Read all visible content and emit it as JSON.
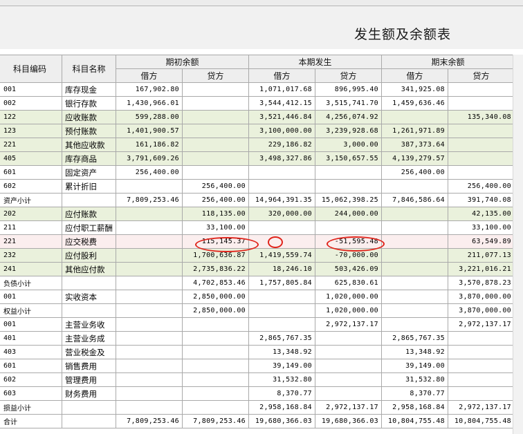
{
  "title": "发生额及余额表",
  "headers": {
    "code": "科目编码",
    "name": "科目名称",
    "groups": [
      "期初余额",
      "本期发生",
      "期末余额"
    ],
    "debit": "借方",
    "credit": "贷方"
  },
  "rows": [
    {
      "code": "001",
      "name": "库存现金",
      "v": [
        "167,902.80",
        "",
        "1,071,017.68",
        "896,995.40",
        "341,925.08",
        ""
      ],
      "hl": ""
    },
    {
      "code": "002",
      "name": "银行存款",
      "v": [
        "1,430,966.01",
        "",
        "3,544,412.15",
        "3,515,741.70",
        "1,459,636.46",
        ""
      ],
      "hl": ""
    },
    {
      "code": "122",
      "name": "应收账款",
      "v": [
        "599,288.00",
        "",
        "3,521,446.84",
        "4,256,074.92",
        "",
        "135,340.08"
      ],
      "hl": "green"
    },
    {
      "code": "123",
      "name": "预付账款",
      "v": [
        "1,401,900.57",
        "",
        "3,100,000.00",
        "3,239,928.68",
        "1,261,971.89",
        ""
      ],
      "hl": "green"
    },
    {
      "code": "221",
      "name": "其他应收款",
      "v": [
        "161,186.82",
        "",
        "229,186.82",
        "3,000.00",
        "387,373.64",
        ""
      ],
      "hl": "green"
    },
    {
      "code": "405",
      "name": "库存商品",
      "v": [
        "3,791,609.26",
        "",
        "3,498,327.86",
        "3,150,657.55",
        "4,139,279.57",
        ""
      ],
      "hl": "green"
    },
    {
      "code": "601",
      "name": "固定资产",
      "v": [
        "256,400.00",
        "",
        "",
        "",
        "256,400.00",
        ""
      ],
      "hl": ""
    },
    {
      "code": "602",
      "name": "累计折旧",
      "v": [
        "",
        "256,400.00",
        "",
        "",
        "",
        "256,400.00"
      ],
      "hl": ""
    },
    {
      "code": "资产小计",
      "name": "",
      "v": [
        "7,809,253.46",
        "256,400.00",
        "14,964,391.35",
        "15,062,398.25",
        "7,846,586.64",
        "391,740.08"
      ],
      "hl": ""
    },
    {
      "code": "202",
      "name": "应付账款",
      "v": [
        "",
        "118,135.00",
        "320,000.00",
        "244,000.00",
        "",
        "42,135.00"
      ],
      "hl": "green"
    },
    {
      "code": "211",
      "name": "应付职工薪酬",
      "v": [
        "",
        "33,100.00",
        "",
        "",
        "",
        "33,100.00"
      ],
      "hl": ""
    },
    {
      "code": "221",
      "name": "应交税费",
      "v": [
        "",
        "115,145.37",
        "",
        "-51,595.48",
        "",
        "63,549.89"
      ],
      "hl": "pink"
    },
    {
      "code": "232",
      "name": "应付股利",
      "v": [
        "",
        "1,700,636.87",
        "1,419,559.74",
        "-70,000.00",
        "",
        "211,077.13"
      ],
      "hl": "green"
    },
    {
      "code": "241",
      "name": "其他应付款",
      "v": [
        "",
        "2,735,836.22",
        "18,246.10",
        "503,426.09",
        "",
        "3,221,016.21"
      ],
      "hl": "green"
    },
    {
      "code": "负债小计",
      "name": "",
      "v": [
        "",
        "4,702,853.46",
        "1,757,805.84",
        "625,830.61",
        "",
        "3,570,878.23"
      ],
      "hl": ""
    },
    {
      "code": "001",
      "name": "实收资本",
      "v": [
        "",
        "2,850,000.00",
        "",
        "1,020,000.00",
        "",
        "3,870,000.00"
      ],
      "hl": ""
    },
    {
      "code": "权益小计",
      "name": "",
      "v": [
        "",
        "2,850,000.00",
        "",
        "1,020,000.00",
        "",
        "3,870,000.00"
      ],
      "hl": ""
    },
    {
      "code": "001",
      "name": "主营业务收",
      "v": [
        "",
        "",
        "",
        "2,972,137.17",
        "",
        "2,972,137.17"
      ],
      "hl": ""
    },
    {
      "code": "401",
      "name": "主营业务成",
      "v": [
        "",
        "",
        "2,865,767.35",
        "",
        "2,865,767.35",
        ""
      ],
      "hl": ""
    },
    {
      "code": "403",
      "name": "营业税金及",
      "v": [
        "",
        "",
        "13,348.92",
        "",
        "13,348.92",
        ""
      ],
      "hl": ""
    },
    {
      "code": "601",
      "name": "销售费用",
      "v": [
        "",
        "",
        "39,149.00",
        "",
        "39,149.00",
        ""
      ],
      "hl": ""
    },
    {
      "code": "602",
      "name": "管理费用",
      "v": [
        "",
        "",
        "31,532.80",
        "",
        "31,532.80",
        ""
      ],
      "hl": ""
    },
    {
      "code": "603",
      "name": "财务费用",
      "v": [
        "",
        "",
        "8,370.77",
        "",
        "8,370.77",
        ""
      ],
      "hl": ""
    },
    {
      "code": "损益小计",
      "name": "",
      "v": [
        "",
        "",
        "2,958,168.84",
        "2,972,137.17",
        "2,958,168.84",
        "2,972,137.17"
      ],
      "hl": ""
    },
    {
      "code": "合计",
      "name": "",
      "v": [
        "7,809,253.46",
        "7,809,253.46",
        "19,680,366.03",
        "19,680,366.03",
        "10,804,755.48",
        "10,804,755.48"
      ],
      "hl": ""
    }
  ],
  "colors": {
    "accent_mark": "#e0231a",
    "highlight_green": "#eaf1dc",
    "highlight_pink": "#fbeeee"
  }
}
